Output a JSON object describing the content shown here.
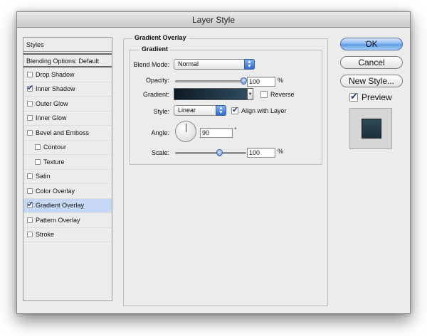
{
  "window": {
    "title": "Layer Style"
  },
  "styles": {
    "header": "Styles",
    "blending_options": "Blending Options: Default",
    "items": [
      {
        "label": "Drop Shadow",
        "checked": false,
        "indent": false,
        "selected": false
      },
      {
        "label": "Inner Shadow",
        "checked": true,
        "indent": false,
        "selected": false
      },
      {
        "label": "Outer Glow",
        "checked": false,
        "indent": false,
        "selected": false
      },
      {
        "label": "Inner Glow",
        "checked": false,
        "indent": false,
        "selected": false
      },
      {
        "label": "Bevel and Emboss",
        "checked": false,
        "indent": false,
        "selected": false
      },
      {
        "label": "Contour",
        "checked": false,
        "indent": true,
        "selected": false
      },
      {
        "label": "Texture",
        "checked": false,
        "indent": true,
        "selected": false
      },
      {
        "label": "Satin",
        "checked": false,
        "indent": false,
        "selected": false
      },
      {
        "label": "Color Overlay",
        "checked": false,
        "indent": false,
        "selected": false
      },
      {
        "label": "Gradient Overlay",
        "checked": true,
        "indent": false,
        "selected": true
      },
      {
        "label": "Pattern Overlay",
        "checked": false,
        "indent": false,
        "selected": false
      },
      {
        "label": "Stroke",
        "checked": false,
        "indent": false,
        "selected": false
      }
    ]
  },
  "gradient_overlay": {
    "title": "Gradient Overlay",
    "subtitle": "Gradient",
    "blend_mode_label": "Blend Mode:",
    "blend_mode_value": "Normal",
    "opacity_label": "Opacity:",
    "opacity_value": "100",
    "opacity_unit": "%",
    "opacity_level": 1.0,
    "gradient_label": "Gradient:",
    "gradient_colors": [
      "#0d1a24",
      "#2e4b5d"
    ],
    "reverse_label": "Reverse",
    "reverse_checked": false,
    "style_label": "Style:",
    "style_value": "Linear",
    "align_label": "Align with Layer",
    "align_checked": true,
    "angle_label": "Angle:",
    "angle_value": "90",
    "angle_unit": "°",
    "scale_label": "Scale:",
    "scale_value": "100",
    "scale_unit": "%",
    "scale_level": 0.5
  },
  "buttons": {
    "ok": "OK",
    "cancel": "Cancel",
    "new_style": "New Style...",
    "preview_label": "Preview",
    "preview_checked": true
  },
  "colors": {
    "accent": "#5e9be8",
    "selected_row": "#c6d8f3"
  }
}
